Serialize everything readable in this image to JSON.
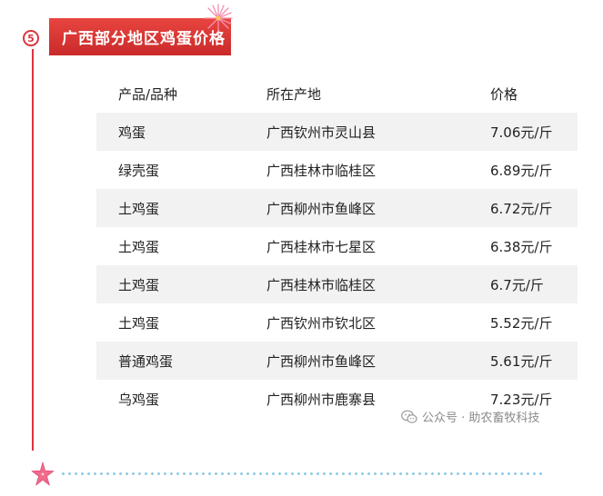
{
  "section": {
    "step_number": "5",
    "title": "广西部分地区鸡蛋价格"
  },
  "table": {
    "headers": [
      "产品/品种",
      "所在产地",
      "价格"
    ],
    "rows": [
      {
        "product": "鸡蛋",
        "origin": "广西钦州市灵山县",
        "price": "7.06元/斤"
      },
      {
        "product": "绿壳蛋",
        "origin": "广西桂林市临桂区",
        "price": "6.89元/斤"
      },
      {
        "product": "土鸡蛋",
        "origin": "广西柳州市鱼峰区",
        "price": "6.72元/斤"
      },
      {
        "product": "土鸡蛋",
        "origin": "广西桂林市七星区",
        "price": "6.38元/斤"
      },
      {
        "product": "土鸡蛋",
        "origin": "广西桂林市临桂区",
        "price": "6.7元/斤"
      },
      {
        "product": "土鸡蛋",
        "origin": "广西钦州市钦北区",
        "price": "5.52元/斤"
      },
      {
        "product": "普通鸡蛋",
        "origin": "广西柳州市鱼峰区",
        "price": "5.61元/斤"
      },
      {
        "product": "乌鸡蛋",
        "origin": "广西柳州市鹿寨县",
        "price": "7.23元/斤"
      }
    ]
  },
  "watermark": {
    "text": "公众号 · 助农畜牧科技",
    "icon": "wechat-icon"
  },
  "colors": {
    "accent": "#d9363e",
    "row_shade": "#f2f2f2",
    "dots": "#8ecae6",
    "starfish": "#f06a8a"
  }
}
